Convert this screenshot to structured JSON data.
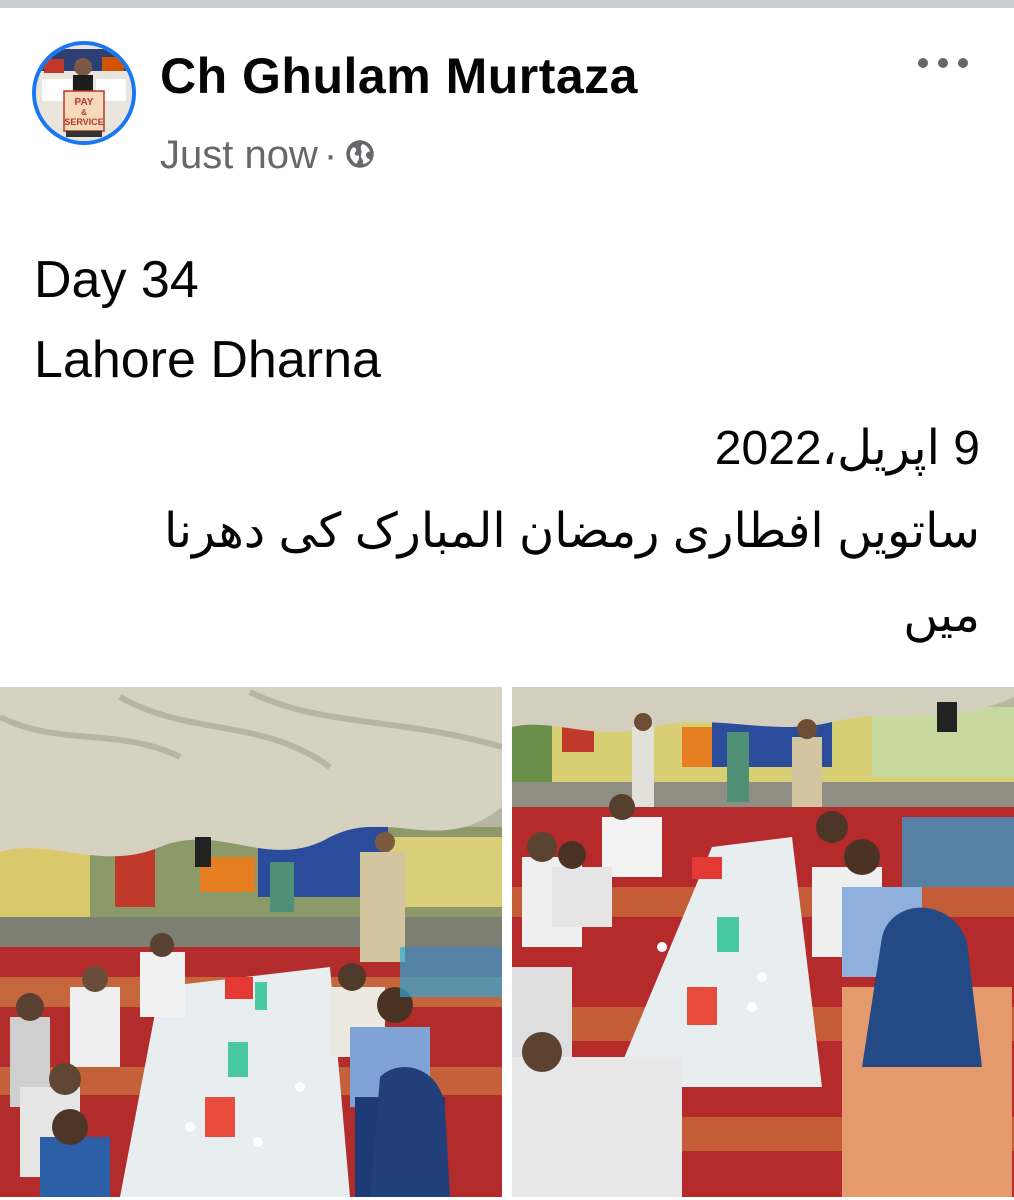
{
  "post": {
    "author": "Ch Ghulam Murtaza",
    "avatar_badge": [
      "PAY",
      "&",
      "SERVICE"
    ],
    "timestamp": "Just now",
    "separator": "·",
    "privacy_icon": "globe-icon",
    "menu_icon": "more-options-icon",
    "text_lines": [
      "Day 34",
      "Lahore Dharna"
    ],
    "urdu_date": "9 اپریل،2022",
    "urdu_line_1": "ساتویں افطاری رمضان المبارک کی دھرنا",
    "urdu_line_2": "میں"
  },
  "colors": {
    "link_blue": "#1877f2",
    "secondary_text": "#65676b",
    "divider": "#c9ccd1"
  },
  "photos": [
    {
      "name": "photo-left-iftar"
    },
    {
      "name": "photo-right-iftar"
    }
  ]
}
